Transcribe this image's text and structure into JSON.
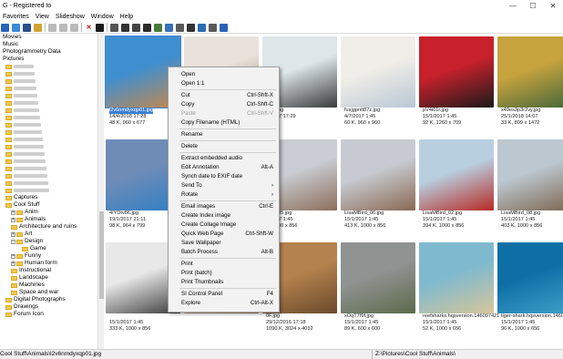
{
  "title": "G - Registered to",
  "window_controls": [
    "—",
    "☐",
    "✕"
  ],
  "menus": [
    "Favorites",
    "View",
    "Slideshow",
    "Window",
    "Help"
  ],
  "tree": {
    "top": [
      "Movies",
      "Music",
      "Photogrammetry Data",
      "Pictures"
    ],
    "mid": [
      "Captures",
      "Cool Stuff",
      "Anim",
      "Animals",
      "Architecture and ruins",
      "Art",
      "Design",
      "Game",
      "Funny",
      "Human form",
      "Instructional",
      "Landscape",
      "Machines",
      "Space and war",
      "Digital Photographs",
      "Drawings",
      "Forum Icon"
    ]
  },
  "thumbs": [
    {
      "name": "l2v6nmdyxqp01.jpg",
      "date": "14/4/2018 17:28",
      "size": "48 K, 960 x 677",
      "colors": [
        "#3f8fd0",
        "#c7874b"
      ],
      "selected": true
    },
    {
      "name": "",
      "date": "",
      "size": "",
      "colors": [
        "#e8e2da",
        "#8a7f70"
      ]
    },
    {
      "name": "zt0z.jpg",
      "date": "1/2017 17:29",
      "size": "",
      "colors": [
        "#dde6e9",
        "#3a3a3a"
      ]
    },
    {
      "name": "fusjgpntt87z.jpg",
      "date": "4/7/2017 1:45",
      "size": "60 K, 960 x 960",
      "colors": [
        "#f0eee8",
        "#b9c7d4"
      ]
    },
    {
      "name": "pV4i01r.jpg",
      "date": "15/1/2017 1:45",
      "size": "92 K, 1260 x 709",
      "colors": [
        "#c9212c",
        "#1a1a1a"
      ]
    },
    {
      "name": "x49es3p3r2vy.jpg",
      "date": "25/1/2018 14:07",
      "size": "33 K, 899 x 1472",
      "colors": [
        "#c7a33e",
        "#44663a"
      ]
    },
    {
      "name": "4IYDtv86.jpg",
      "date": "19/1/2017 21:11",
      "size": "98 K, 964 x 799",
      "colors": [
        "#6f8cb7",
        "#2f7fc4"
      ]
    },
    {
      "name": "",
      "date": "",
      "size": "",
      "colors": [
        "#d7d1cb",
        "#7e6a58"
      ]
    },
    {
      "name": "Bird_05.jpg",
      "date": "1/2017 1:45",
      "size": "K, 1000 x 856",
      "colors": [
        "#c9ccd2",
        "#8c6e5b"
      ]
    },
    {
      "name": "LisaMBird_06.jpg",
      "date": "15/1/2017 1:45",
      "size": "413 K, 1000 x 856",
      "colors": [
        "#c7cbd1",
        "#8a6853"
      ]
    },
    {
      "name": "LisaMBird_02.jpg",
      "date": "15/1/2017 1:45",
      "size": "394 K, 1000 x 856",
      "colors": [
        "#b8cfe0",
        "#b72a24"
      ]
    },
    {
      "name": "LisaMBird_08.jpg",
      "date": "15/1/2017 1:45",
      "size": "403 K, 1000 x 856",
      "colors": [
        "#bcc7cf",
        "#7d6650"
      ]
    },
    {
      "name": "",
      "date": "15/1/2017 1:45",
      "size": "333 K, 1000 x 856",
      "colors": [
        "#e8e8e8",
        "#3c3c3c"
      ]
    },
    {
      "name": "",
      "date": "",
      "size": "",
      "colors": [
        "#d9d9d9",
        "#b08855"
      ]
    },
    {
      "name": "0F.jpg",
      "date": "29/12/2016 17:18",
      "size": "1090 K, 3024 x 4032",
      "colors": [
        "#b4824e",
        "#6b4a2c"
      ]
    },
    {
      "name": "xOqT7f9f.jpg",
      "date": "15/1/2017 1:45",
      "size": "89 K, 600 x 600",
      "colors": [
        "#8f9392",
        "#5d6a4b"
      ]
    },
    {
      "name": "reefsharks.hqsversion.14609742154",
      "date": "15/1/2017 1:45",
      "size": "52 K, 1000 x 656",
      "colors": [
        "#7fb9cf",
        "#d7c69a"
      ]
    },
    {
      "name": "tiger-shark.hqsversion.14609742",
      "date": "15/1/2017 1:45",
      "size": "96 K, 1000 x 656",
      "colors": [
        "#0e6fa6",
        "#3fa0c9"
      ]
    }
  ],
  "context_menu": [
    {
      "label": "Open",
      "sc": ""
    },
    {
      "label": "Open 1:1",
      "sc": ""
    },
    {
      "sep": true
    },
    {
      "label": "Cut",
      "sc": "Ctrl-Shft-X"
    },
    {
      "label": "Copy",
      "sc": "Ctrl-Shft-C"
    },
    {
      "label": "Paste",
      "sc": "Ctrl-Shft-V",
      "disabled": true
    },
    {
      "label": "Copy Filename (HTML)",
      "sc": ""
    },
    {
      "sep": true
    },
    {
      "label": "Rename",
      "sc": ""
    },
    {
      "sep": true
    },
    {
      "label": "Delete",
      "sc": ""
    },
    {
      "sep": true
    },
    {
      "label": "Extract embedded audio",
      "sc": ""
    },
    {
      "label": "Edit Annotation",
      "sc": "Alt-A"
    },
    {
      "label": "Synch date to EXIF date",
      "sc": ""
    },
    {
      "label": "Send To",
      "sc": "›"
    },
    {
      "label": "Rotate",
      "sc": "›"
    },
    {
      "sep": true
    },
    {
      "label": "Email images",
      "sc": "Ctrl-E"
    },
    {
      "label": "Create Index image",
      "sc": ""
    },
    {
      "label": "Create Collage Image",
      "sc": ""
    },
    {
      "label": "Quick Web Page",
      "sc": "Ctrl-Shft-W"
    },
    {
      "label": "Save Wallpaper",
      "sc": ""
    },
    {
      "label": "Batch Process",
      "sc": "Alt-B"
    },
    {
      "sep": true
    },
    {
      "label": "Print",
      "sc": ""
    },
    {
      "label": "Print (batch)",
      "sc": ""
    },
    {
      "label": "Print Thumbnails",
      "sc": ""
    },
    {
      "sep": true
    },
    {
      "label": "SI Control Panel",
      "sc": "F4"
    },
    {
      "label": "Explore",
      "sc": "Ctrl-Alt-X"
    }
  ],
  "status": {
    "path": "Cool Stuff\\Animals\\l2v6nmdyxqp01.jpg",
    "folder": "Z:\\Pictures\\Cool Stuff\\Animals\\"
  }
}
